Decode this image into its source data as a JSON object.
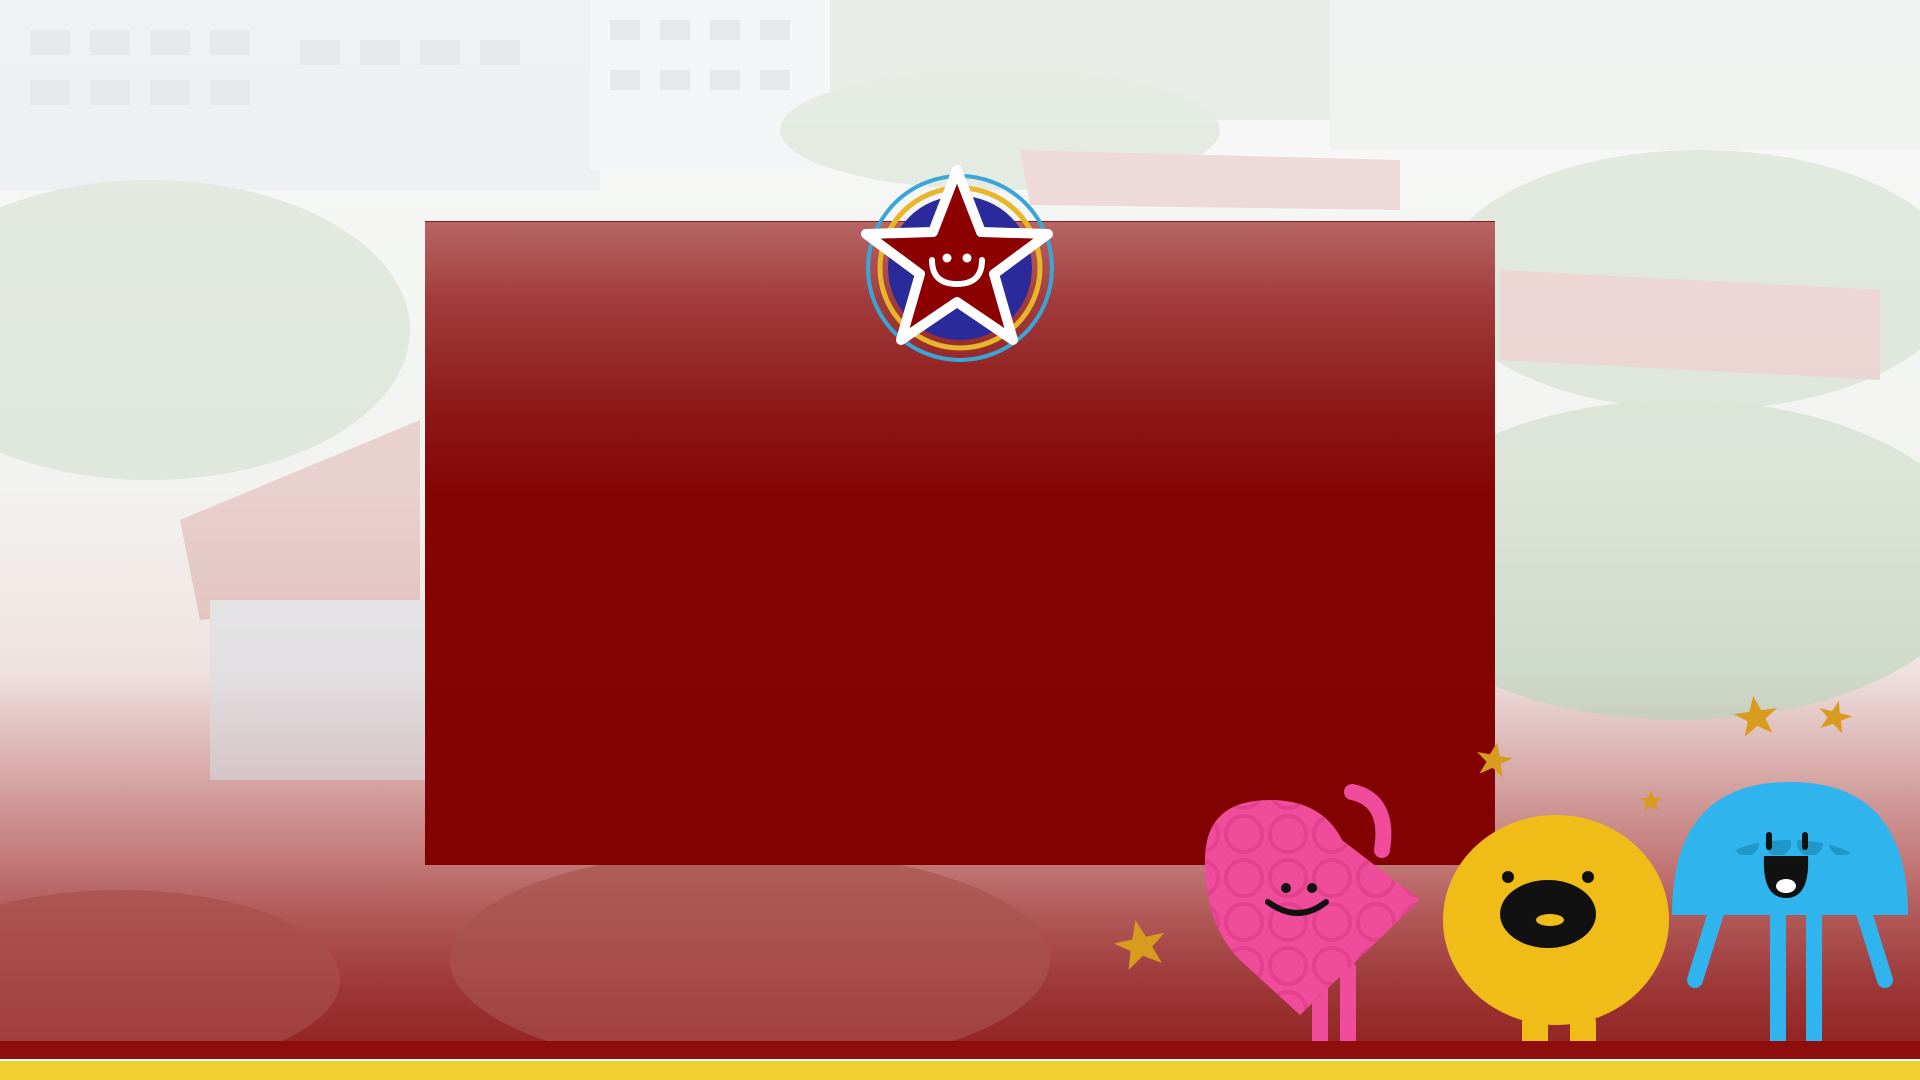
{
  "colors": {
    "panel": "#820202",
    "footer_maroon": "#8e0d0d",
    "footer_gold": "#f1cf2f",
    "badge_red": "#8c0000",
    "badge_ring_blue": "#3aa6d8",
    "badge_ring_gold": "#e9b62a",
    "mascot_pink": "#f04c9c",
    "mascot_yellow": "#f0bd18",
    "mascot_blue": "#2fb4ee",
    "star_gold": "#d89a1f"
  },
  "icons": {
    "badge": "smiling-star-badge-icon",
    "pink": "pink-heart-mascot-icon",
    "yellow": "yellow-round-mascot-icon",
    "blue": "blue-jellyfish-mascot-icon",
    "sparkle": "gold-star-icon"
  }
}
